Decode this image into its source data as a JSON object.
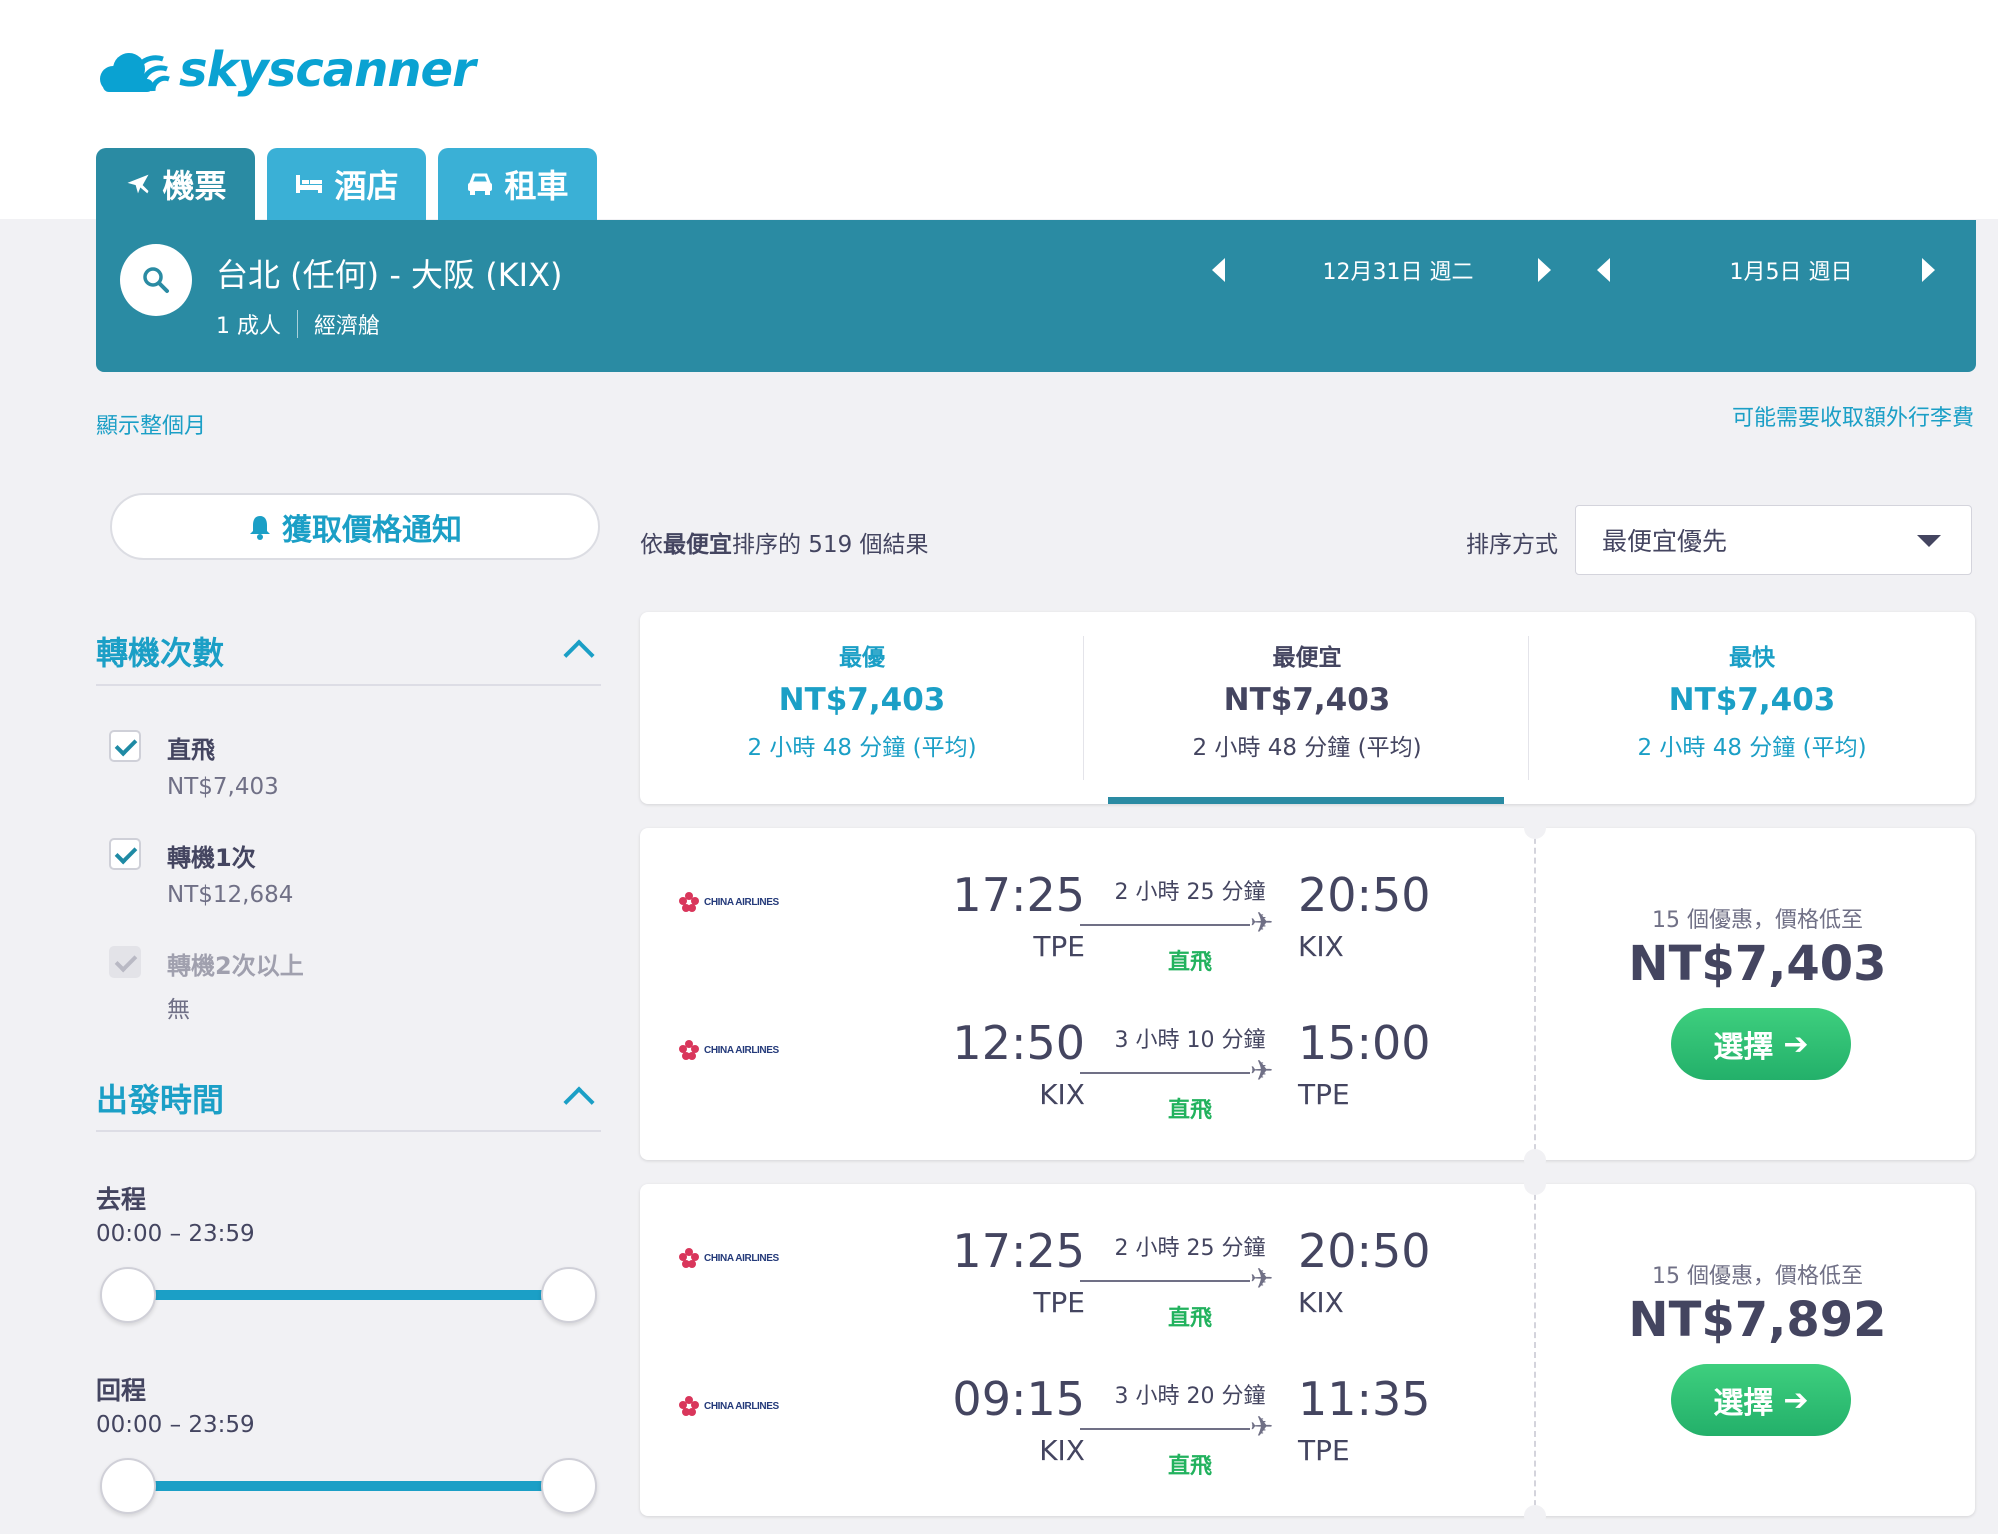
{
  "brand": {
    "name": "skyscanner",
    "color": "#0aa2d2"
  },
  "tabs": [
    {
      "label": "機票",
      "icon": "plane-icon",
      "active": true
    },
    {
      "label": "酒店",
      "icon": "bed-icon",
      "active": false
    },
    {
      "label": "租車",
      "icon": "car-icon",
      "active": false
    }
  ],
  "search": {
    "route": "台北 (任何) - 大阪 (KIX)",
    "passengers": "1 成人",
    "cabin": "經濟艙",
    "depart_date": "12月31日 週二",
    "return_date": "1月5日 週日"
  },
  "links": {
    "show_month": "顯示整個月",
    "baggage_fee": "可能需要收取額外行李費"
  },
  "price_alert": {
    "label": "獲取價格通知"
  },
  "filters": {
    "stops": {
      "title": "轉機次數",
      "options": [
        {
          "label": "直飛",
          "price": "NT$7,403",
          "checked": true,
          "disabled": false
        },
        {
          "label": "轉機1次",
          "price": "NT$12,684",
          "checked": true,
          "disabled": false
        },
        {
          "label": "轉機2次以上",
          "price": "無",
          "checked": true,
          "disabled": true
        }
      ]
    },
    "times": {
      "title": "出發時間",
      "outbound": {
        "label": "去程",
        "range": "00:00 – 23:59",
        "min": 0,
        "max": 1
      },
      "inbound": {
        "label": "回程",
        "range": "00:00 – 23:59",
        "min": 0,
        "max": 1
      }
    }
  },
  "results": {
    "prefix": "依",
    "sort_bold": "最便宜",
    "suffix": "排序的 519 個結果",
    "sort_label": "排序方式",
    "sort_value": "最便宜優先"
  },
  "summary": [
    {
      "heading": "最優",
      "price": "NT$7,403",
      "duration": "2 小時 48 分鐘 (平均)"
    },
    {
      "heading": "最便宜",
      "price": "NT$7,403",
      "duration": "2 小時 48 分鐘 (平均)"
    },
    {
      "heading": "最快",
      "price": "NT$7,403",
      "duration": "2 小時 48 分鐘 (平均)"
    }
  ],
  "itineraries": [
    {
      "legs": [
        {
          "airline": "CHINA AIRLINES",
          "depart_time": "17:25",
          "depart_code": "TPE",
          "duration": "2 小時 25 分鐘",
          "stops": "直飛",
          "arrive_time": "20:50",
          "arrive_code": "KIX"
        },
        {
          "airline": "CHINA AIRLINES",
          "depart_time": "12:50",
          "depart_code": "KIX",
          "duration": "3 小時 10 分鐘",
          "stops": "直飛",
          "arrive_time": "15:00",
          "arrive_code": "TPE"
        }
      ],
      "deals": "15 個優惠，價格低至",
      "price": "NT$7,403",
      "button": "選擇"
    },
    {
      "legs": [
        {
          "airline": "CHINA AIRLINES",
          "depart_time": "17:25",
          "depart_code": "TPE",
          "duration": "2 小時 25 分鐘",
          "stops": "直飛",
          "arrive_time": "20:50",
          "arrive_code": "KIX"
        },
        {
          "airline": "CHINA AIRLINES",
          "depart_time": "09:15",
          "depart_code": "KIX",
          "duration": "3 小時 20 分鐘",
          "stops": "直飛",
          "arrive_time": "11:35",
          "arrive_code": "TPE"
        }
      ],
      "deals": "15 個優惠，價格低至",
      "price": "NT$7,892",
      "button": "選擇"
    }
  ],
  "colors": {
    "primary": "#2a8ba3",
    "accent": "#1b9fc6",
    "green": "#23b06a"
  }
}
